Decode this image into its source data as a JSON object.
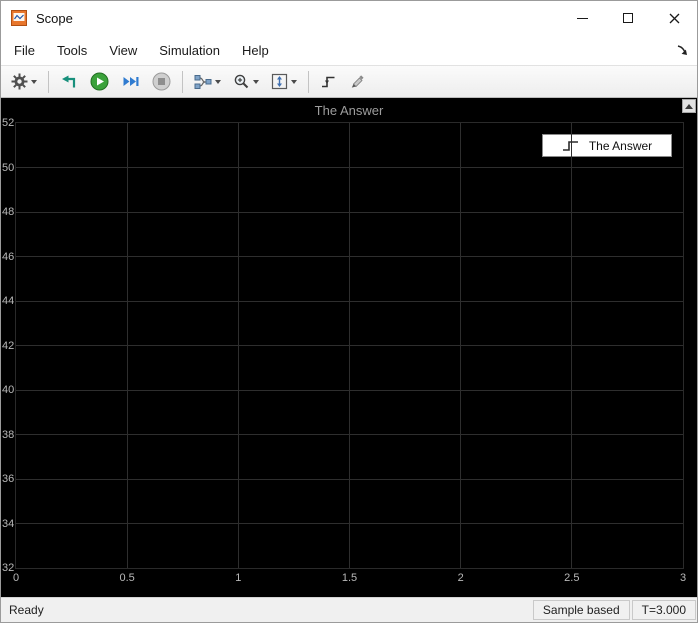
{
  "window": {
    "title": "Scope"
  },
  "menu": {
    "items": [
      "File",
      "Tools",
      "View",
      "Simulation",
      "Help"
    ]
  },
  "toolbar": {
    "items": [
      {
        "name": "settings-gear-icon",
        "dropdown": true
      },
      {
        "name": "separator"
      },
      {
        "name": "highlight-block-icon"
      },
      {
        "name": "run-icon"
      },
      {
        "name": "step-forward-icon"
      },
      {
        "name": "stop-icon"
      },
      {
        "name": "separator"
      },
      {
        "name": "signal-selector-icon",
        "dropdown": true
      },
      {
        "name": "zoom-icon",
        "dropdown": true
      },
      {
        "name": "span-icon",
        "dropdown": true
      },
      {
        "name": "separator"
      },
      {
        "name": "trigger-icon"
      },
      {
        "name": "measurements-icon"
      }
    ]
  },
  "chart_data": {
    "type": "line",
    "title": "The Answer",
    "xlabel": "",
    "ylabel": "",
    "xlim": [
      0,
      3
    ],
    "ylim": [
      32,
      52
    ],
    "x_ticks": [
      0,
      0.5,
      1,
      1.5,
      2,
      2.5,
      3
    ],
    "x_tick_labels": [
      "0",
      "0.5",
      "1",
      "1.5",
      "2",
      "2.5",
      "3"
    ],
    "y_ticks": [
      32,
      34,
      36,
      38,
      40,
      42,
      44,
      46,
      48,
      50,
      52
    ],
    "grid": true,
    "legend": {
      "entries": [
        "The Answer"
      ],
      "position": "top-right"
    },
    "series": [
      {
        "name": "The Answer",
        "values": []
      }
    ],
    "background": "#000000",
    "colors": {
      "grid": "#2e2e2e",
      "tick_label": "#b9b9b9",
      "title": "#9d9d9d"
    }
  },
  "status_bar": {
    "state": "Ready",
    "mode": "Sample based",
    "time": "T=3.000"
  }
}
